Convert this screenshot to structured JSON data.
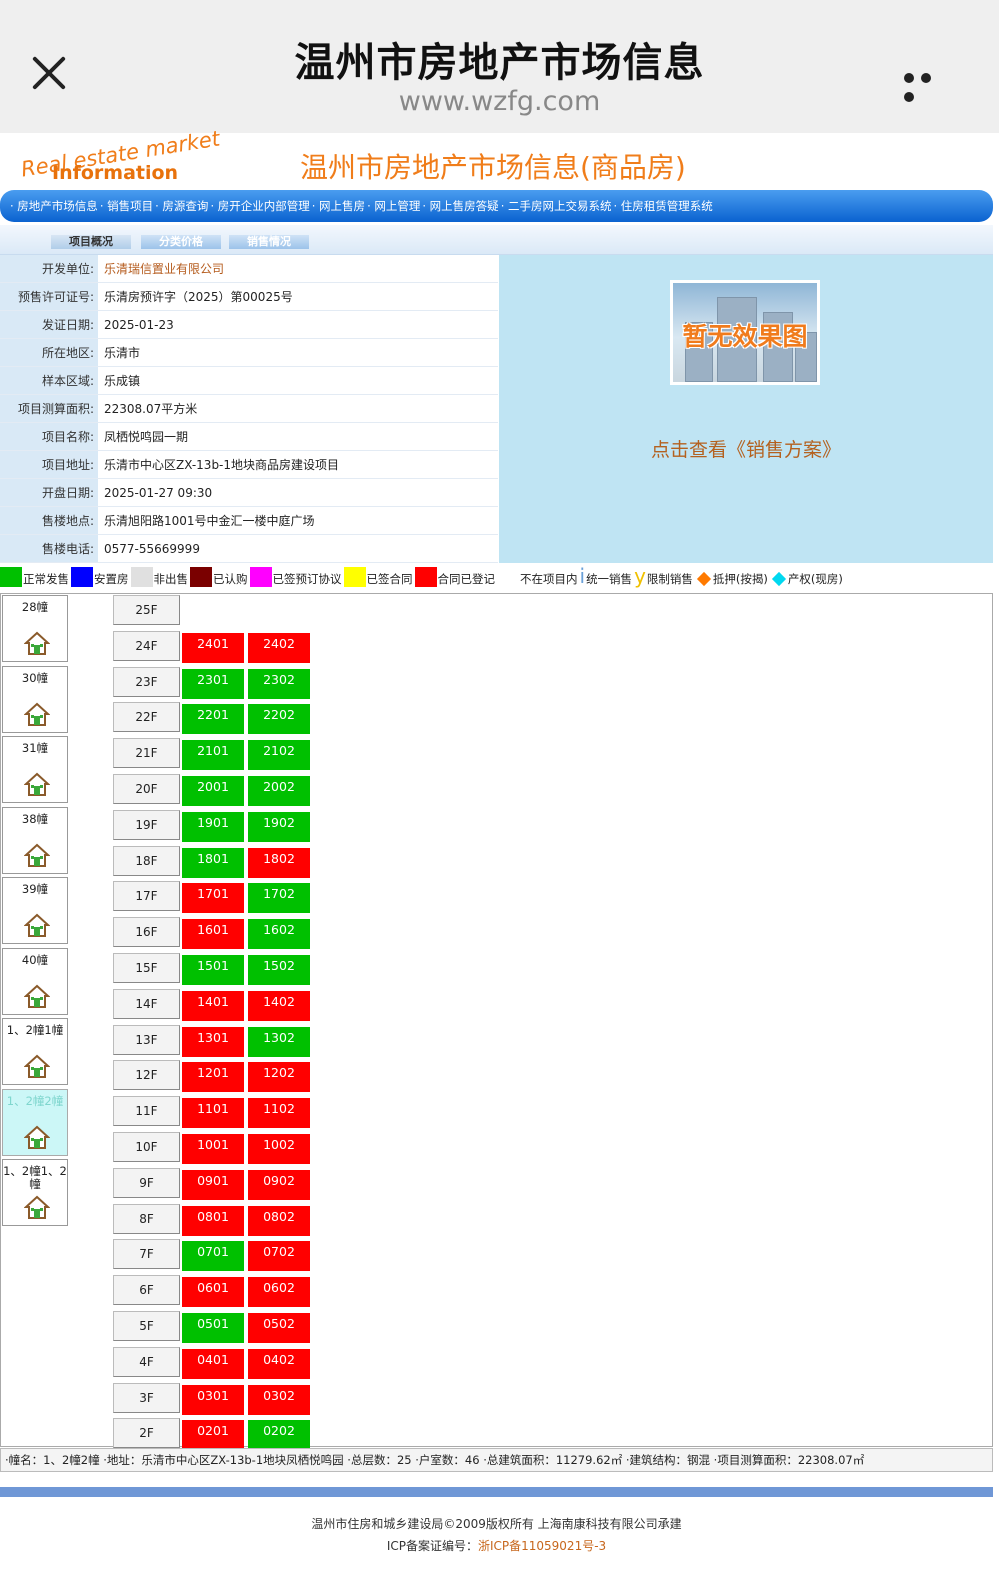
{
  "browser": {
    "title": "温州市房地产市场信息",
    "url": "www.wzfg.com"
  },
  "header": {
    "logo_line1": "Real estate market",
    "logo_line2": "Information",
    "site_title": "温州市房地产市场信息(商品房)"
  },
  "nav": [
    "· 房地产市场信息",
    "· 销售项目",
    "· 房源查询",
    "· 房开企业内部管理",
    "· 网上售房",
    "· 网上管理",
    "· 网上售房答疑",
    "· 二手房网上交易系统",
    "· 住房租赁管理系统"
  ],
  "tabs": [
    "项目概况",
    "分类价格",
    "销售情况"
  ],
  "info": [
    {
      "label": "开发单位:",
      "value": "乐清瑞信置业有限公司",
      "link": true
    },
    {
      "label": "预售许可证号:",
      "value": "乐清房预许字（2025）第00025号"
    },
    {
      "label": "发证日期:",
      "value": "2025-01-23"
    },
    {
      "label": "所在地区:",
      "value": "乐清市"
    },
    {
      "label": "样本区域:",
      "value": "乐成镇"
    },
    {
      "label": "项目测算面积:",
      "value": "22308.07平方米"
    },
    {
      "label": "项目名称:",
      "value": "凤栖悦鸣园一期"
    },
    {
      "label": "项目地址:",
      "value": "乐清市中心区ZX-13b-1地块商品房建设项目"
    },
    {
      "label": "开盘日期:",
      "value": "2025-01-27 09:30"
    },
    {
      "label": "售楼地点:",
      "value": "乐清旭阳路1001号中金汇一楼中庭广场"
    },
    {
      "label": "售楼电话:",
      "value": "0577-55669999"
    }
  ],
  "effect_image_text": "暂无效果图",
  "sales_plan_link": "点击查看《销售方案》",
  "legend": [
    {
      "label": "正常发售",
      "color": "#00c000",
      "type": "swatch"
    },
    {
      "label": "安置房",
      "color": "#0000ff",
      "type": "swatch"
    },
    {
      "label": "非出售",
      "color": "#e0e0e0",
      "type": "swatch"
    },
    {
      "label": "已认购",
      "color": "#7a0000",
      "type": "swatch"
    },
    {
      "label": "已签预订协议",
      "color": "#ff00ff",
      "type": "swatch"
    },
    {
      "label": "已签合同",
      "color": "#ffff00",
      "type": "swatch"
    },
    {
      "label": "合同已登记",
      "color": "#ff0000",
      "type": "swatch"
    },
    {
      "label": "不在项目内",
      "color": "#ffffff",
      "type": "swatch"
    },
    {
      "label": "统一销售",
      "marker": "i",
      "type": "letter",
      "color": "#6aa0d8"
    },
    {
      "label": "限制销售",
      "marker": "y",
      "type": "letter",
      "color": "#f0c000"
    },
    {
      "label": "抵押(按揭)",
      "color": "#ff7a00",
      "type": "diamond"
    },
    {
      "label": "产权(现房)",
      "color": "#00d8f0",
      "type": "diamond"
    }
  ],
  "buildings": [
    {
      "name": "28幢"
    },
    {
      "name": "30幢"
    },
    {
      "name": "31幢"
    },
    {
      "name": "38幢"
    },
    {
      "name": "39幢"
    },
    {
      "name": "40幢"
    },
    {
      "name": "1、2幢1幢"
    },
    {
      "name": "1、2幢2幢",
      "selected": true
    },
    {
      "name": "1、2幢1、2幢"
    }
  ],
  "floors": [
    {
      "floor": "25F",
      "units": []
    },
    {
      "floor": "24F",
      "units": [
        [
          "2401",
          "red"
        ],
        [
          "2402",
          "red"
        ]
      ]
    },
    {
      "floor": "23F",
      "units": [
        [
          "2301",
          "green"
        ],
        [
          "2302",
          "green"
        ]
      ]
    },
    {
      "floor": "22F",
      "units": [
        [
          "2201",
          "green"
        ],
        [
          "2202",
          "green"
        ]
      ]
    },
    {
      "floor": "21F",
      "units": [
        [
          "2101",
          "green"
        ],
        [
          "2102",
          "green"
        ]
      ]
    },
    {
      "floor": "20F",
      "units": [
        [
          "2001",
          "green"
        ],
        [
          "2002",
          "green"
        ]
      ]
    },
    {
      "floor": "19F",
      "units": [
        [
          "1901",
          "green"
        ],
        [
          "1902",
          "green"
        ]
      ]
    },
    {
      "floor": "18F",
      "units": [
        [
          "1801",
          "green"
        ],
        [
          "1802",
          "red"
        ]
      ]
    },
    {
      "floor": "17F",
      "units": [
        [
          "1701",
          "red"
        ],
        [
          "1702",
          "green"
        ]
      ]
    },
    {
      "floor": "16F",
      "units": [
        [
          "1601",
          "red"
        ],
        [
          "1602",
          "green"
        ]
      ]
    },
    {
      "floor": "15F",
      "units": [
        [
          "1501",
          "green"
        ],
        [
          "1502",
          "green"
        ]
      ]
    },
    {
      "floor": "14F",
      "units": [
        [
          "1401",
          "red"
        ],
        [
          "1402",
          "red"
        ]
      ]
    },
    {
      "floor": "13F",
      "units": [
        [
          "1301",
          "red"
        ],
        [
          "1302",
          "green"
        ]
      ]
    },
    {
      "floor": "12F",
      "units": [
        [
          "1201",
          "red"
        ],
        [
          "1202",
          "red"
        ]
      ]
    },
    {
      "floor": "11F",
      "units": [
        [
          "1101",
          "red"
        ],
        [
          "1102",
          "red"
        ]
      ]
    },
    {
      "floor": "10F",
      "units": [
        [
          "1001",
          "red"
        ],
        [
          "1002",
          "red"
        ]
      ]
    },
    {
      "floor": "9F",
      "units": [
        [
          "0901",
          "red"
        ],
        [
          "0902",
          "red"
        ]
      ]
    },
    {
      "floor": "8F",
      "units": [
        [
          "0801",
          "red"
        ],
        [
          "0802",
          "red"
        ]
      ]
    },
    {
      "floor": "7F",
      "units": [
        [
          "0701",
          "green"
        ],
        [
          "0702",
          "red"
        ]
      ]
    },
    {
      "floor": "6F",
      "units": [
        [
          "0601",
          "red"
        ],
        [
          "0602",
          "red"
        ]
      ]
    },
    {
      "floor": "5F",
      "units": [
        [
          "0501",
          "green"
        ],
        [
          "0502",
          "red"
        ]
      ]
    },
    {
      "floor": "4F",
      "units": [
        [
          "0401",
          "red"
        ],
        [
          "0402",
          "red"
        ]
      ]
    },
    {
      "floor": "3F",
      "units": [
        [
          "0301",
          "red"
        ],
        [
          "0302",
          "red"
        ]
      ]
    },
    {
      "floor": "2F",
      "units": [
        [
          "0201",
          "red"
        ],
        [
          "0202",
          "green"
        ]
      ]
    }
  ],
  "statusbar": "·幢名：1、2幢2幢 ·地址：乐清市中心区ZX-13b-1地块凤栖悦鸣园 ·总层数：25 ·户室数：46 ·总建筑面积：11279.62㎡ ·建筑结构：钢混 ·项目测算面积：22308.07㎡",
  "footer": {
    "line1": "温州市住房和城乡建设局©2009版权所有  上海南康科技有限公司承建",
    "icp_label": "ICP备案证编号：",
    "icp_value": "浙ICP备11059021号-3"
  }
}
